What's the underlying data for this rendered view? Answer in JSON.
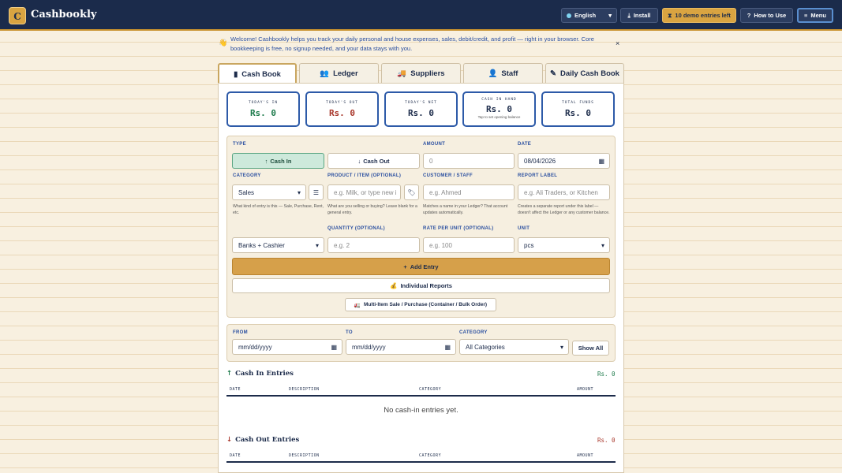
{
  "app": {
    "logo_letter": "C",
    "name": "Cashbookly"
  },
  "topbar": {
    "language": "English",
    "install": "Install",
    "demo": "10 demo entries left",
    "howto": "How to Use",
    "menu": "Menu"
  },
  "welcome": {
    "text": "Welcome! Cashbookly helps you track your daily personal and house expenses, sales, debit/credit, and profit — right in your browser. Core bookkeeping is free, no signup needed, and your data stays with you.",
    "close": "×"
  },
  "tabs": [
    "Cash Book",
    "Ledger",
    "Suppliers",
    "Staff",
    "Daily Cash Book"
  ],
  "stats": [
    {
      "label": "Today's In",
      "value": "Rs. 0",
      "sub": ""
    },
    {
      "label": "Today's Out",
      "value": "Rs. 0",
      "sub": ""
    },
    {
      "label": "Today's Net",
      "value": "Rs. 0",
      "sub": ""
    },
    {
      "label": "Cash in Hand",
      "value": "Rs. 0",
      "sub": "Tap to set opening balance"
    },
    {
      "label": "Total Funds",
      "value": "Rs. 0",
      "sub": ""
    }
  ],
  "form": {
    "type_label": "TYPE",
    "cash_in": "Cash In",
    "cash_out": "Cash Out",
    "amount_label": "AMOUNT",
    "amount_placeholder": "0",
    "date_label": "DATE",
    "date_value": "08/04/2026",
    "category_label": "CATEGORY",
    "category_value": "Sales",
    "category_hint": "What kind of entry is this — Sale, Purchase, Rent, etc.",
    "product_label": "PRODUCT / ITEM (OPTIONAL)",
    "product_placeholder": "e.g. Milk, or type new i",
    "product_hint": "What are you selling or buying? Leave blank for a general entry.",
    "customer_label": "CUSTOMER / STAFF",
    "customer_placeholder": "e.g. Ahmed",
    "customer_hint": "Matches a name in your Ledger? That account updates automatically.",
    "report_label": "REPORT LABEL",
    "report_placeholder": "e.g. Ali Traders, or Kitchen",
    "report_hint": "Creates a separate report under this label — doesn't affect the Ledger or any customer balance.",
    "account_value": "Banks + Cashier",
    "qty_label": "QUANTITY (OPTIONAL)",
    "qty_placeholder": "e.g. 2",
    "rate_label": "RATE PER UNIT (OPTIONAL)",
    "rate_placeholder": "e.g. 100",
    "unit_label": "UNIT",
    "unit_value": "pcs",
    "add": "Add Entry",
    "reports": "Individual Reports",
    "multi": "Multi-Item Sale / Purchase (Container / Bulk Order)"
  },
  "filter": {
    "from_label": "FROM",
    "from_placeholder": "mm/dd/yyyy",
    "to_label": "TO",
    "to_placeholder": "mm/dd/yyyy",
    "category_label": "CATEGORY",
    "category_value": "All Categories",
    "show_all": "Show All"
  },
  "cash_in_section": {
    "title": "Cash In Entries",
    "total": "Rs. 0",
    "columns": [
      "DATE",
      "DESCRIPTION",
      "CATEGORY",
      "AMOUNT"
    ],
    "empty": "No cash-in entries yet."
  },
  "cash_out_section": {
    "title": "Cash Out Entries",
    "total": "Rs. 0",
    "columns": [
      "DATE",
      "DESCRIPTION",
      "CATEGORY",
      "AMOUNT"
    ]
  },
  "colors": {
    "navy": "#1b2b4b",
    "gold": "#d9a441",
    "green": "#1d7a4b",
    "red": "#a8362a",
    "blue": "#2a4fa0"
  }
}
